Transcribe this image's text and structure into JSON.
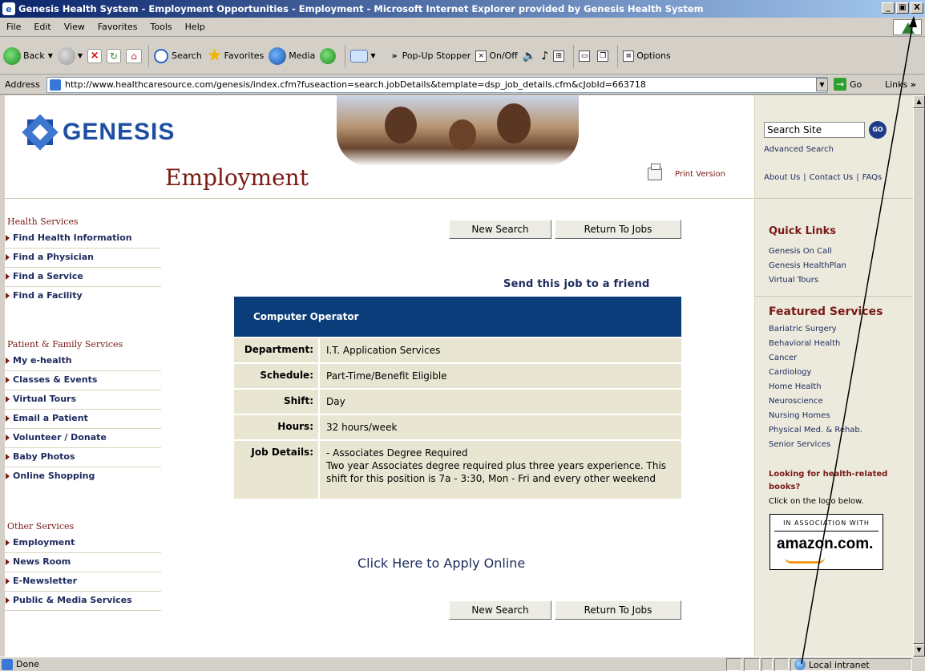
{
  "window": {
    "title": "Genesis Health System - Employment Opportunities - Employment - Microsoft Internet Explorer provided by Genesis Health System",
    "minimize": "_",
    "maximize": "̅̅",
    "close": "X"
  },
  "menu": [
    "File",
    "Edit",
    "View",
    "Favorites",
    "Tools",
    "Help"
  ],
  "toolbar": {
    "back": "Back",
    "search": "Search",
    "favorites": "Favorites",
    "media": "Media",
    "chevron": "»",
    "popup_stopper": "Pop-Up Stopper",
    "onoff": "On/Off",
    "options": "Options"
  },
  "address": {
    "label": "Address",
    "url": "http://www.healthcaresource.com/genesis/index.cfm?fuseaction=search.jobDetails&template=dsp_job_details.cfm&cJobId=663718",
    "go": "Go",
    "links": "Links",
    "links_chevron": "»"
  },
  "header": {
    "logo": "GENESIS",
    "page_title": "Employment",
    "print": "Print Version"
  },
  "leftnav": {
    "health_heading": "Health Services",
    "health": [
      "Find Health Information",
      "Find a Physician",
      "Find a Service",
      "Find a Facility"
    ],
    "patient_heading": "Patient & Family Services",
    "patient": [
      "My e-health",
      "Classes & Events",
      "Virtual Tours",
      "Email a Patient",
      "Volunteer / Donate",
      "Baby Photos",
      "Online Shopping"
    ],
    "other_heading": "Other Services",
    "other": [
      "Employment",
      "News Room",
      "E-Newsletter",
      "Public & Media Services"
    ]
  },
  "main": {
    "new_search": "New Search",
    "return_jobs": "Return To Jobs",
    "send_friend": "Send this job to a friend",
    "job_title": "Computer Operator",
    "rows": [
      {
        "label": "Department:",
        "value": "I.T. Application Services"
      },
      {
        "label": "Schedule:",
        "value": "Part-Time/Benefit Eligible"
      },
      {
        "label": "Shift:",
        "value": "Day"
      },
      {
        "label": "Hours:",
        "value": "32 hours/week"
      }
    ],
    "details_label": "Job Details:",
    "details_line1": "- Associates Degree Required",
    "details_line2": "Two year Associates degree required plus three years experience. This shift for this position is 7a - 3:30, Mon - Fri and every other weekend",
    "apply": "Click Here to Apply Online"
  },
  "rightrail": {
    "search_value": "Search Site",
    "go": "GO",
    "advanced": "Advanced Search",
    "about": "About Us",
    "contact": "Contact Us",
    "faqs": "FAQs",
    "sep": "|",
    "quick_heading": "Quick Links",
    "quick": [
      "Genesis On Call",
      "Genesis HealthPlan",
      "Virtual Tours"
    ],
    "featured_heading": "Featured Services",
    "featured": [
      "Bariatric Surgery",
      "Behavioral Health",
      "Cancer",
      "Cardiology",
      "Home Health",
      "Neuroscience",
      "Nursing Homes",
      "Physical Med. & Rehab.",
      "Senior Services"
    ],
    "books_question": "Looking for health-related books?",
    "books_click": "Click on the logo below.",
    "amazon_assoc": "IN ASSOCIATION WITH",
    "amazon_word": "amazon.com."
  },
  "status": {
    "text": "Done",
    "zone": "Local intranet"
  }
}
